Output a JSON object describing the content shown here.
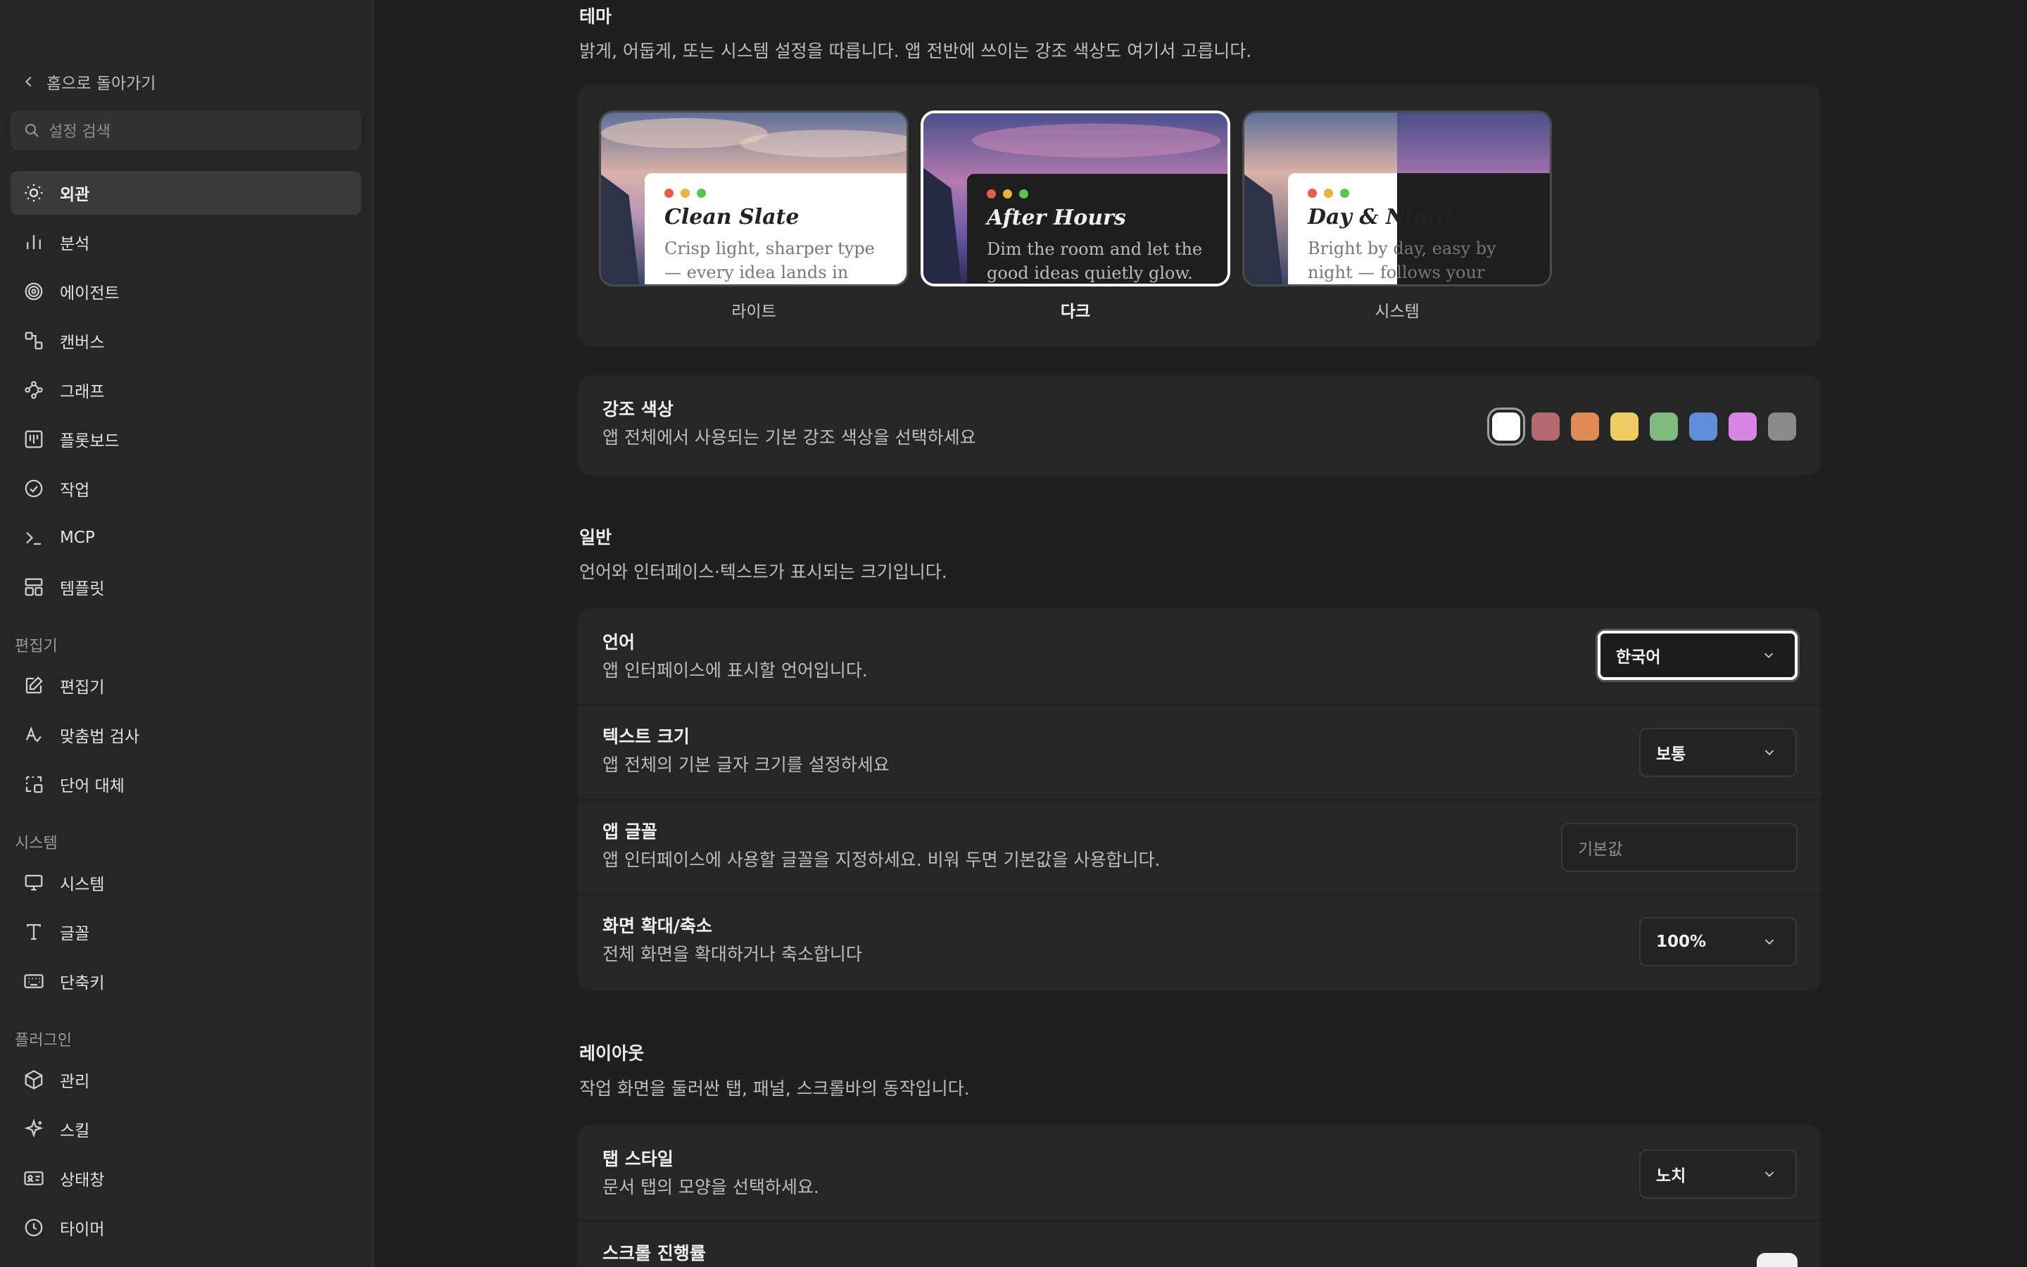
{
  "sidebar": {
    "back_label": "홈으로 돌아가기",
    "search_placeholder": "설정 검색",
    "items": [
      {
        "label": "외관",
        "icon": "sun-icon"
      },
      {
        "label": "분석",
        "icon": "bar-chart-icon"
      },
      {
        "label": "에이전트",
        "icon": "spiral-icon"
      },
      {
        "label": "캔버스",
        "icon": "canvas-icon"
      },
      {
        "label": "그래프",
        "icon": "graph-icon"
      },
      {
        "label": "플롯보드",
        "icon": "board-icon"
      },
      {
        "label": "작업",
        "icon": "check-circle-icon"
      },
      {
        "label": "MCP",
        "icon": "terminal-icon"
      },
      {
        "label": "템플릿",
        "icon": "template-icon"
      }
    ],
    "section_editor": "편집기",
    "editor_items": [
      {
        "label": "편집기",
        "icon": "edit-icon"
      },
      {
        "label": "맞춤법 검사",
        "icon": "spellcheck-icon"
      },
      {
        "label": "단어 대체",
        "icon": "replace-icon"
      }
    ],
    "section_system": "시스템",
    "system_items": [
      {
        "label": "시스템",
        "icon": "monitor-icon"
      },
      {
        "label": "글꼴",
        "icon": "font-icon"
      },
      {
        "label": "단축키",
        "icon": "keyboard-icon"
      }
    ],
    "section_plugins": "플러그인",
    "plugin_items": [
      {
        "label": "관리",
        "icon": "package-icon"
      },
      {
        "label": "스킬",
        "icon": "sparkle-icon"
      },
      {
        "label": "상태창",
        "icon": "id-card-icon"
      },
      {
        "label": "타이머",
        "icon": "clock-icon"
      }
    ]
  },
  "theme": {
    "title": "테마",
    "description": "밝게, 어둡게, 또는 시스템 설정을 따릅니다. 앱 전반에 쓰이는 강조 색상도 여기서 고릅니다.",
    "options": [
      {
        "label": "라이트",
        "card_title": "Clean Slate",
        "card_text": "Crisp light, sharper type — every idea lands in focus."
      },
      {
        "label": "다크",
        "card_title": "After Hours",
        "card_text": "Dim the room and let the good ideas quietly glow."
      },
      {
        "label": "시스템",
        "card_title": "Day & Night",
        "card_text": "Bright by day, easy by night — follows your system."
      }
    ],
    "selected": "다크"
  },
  "accent": {
    "title": "강조 색상",
    "description": "앱 전체에서 사용되는 기본 강조 색상을 선택하세요",
    "colors": [
      "#ffffff",
      "#b56a70",
      "#e08a55",
      "#f0cd62",
      "#7fba7e",
      "#5f8fd9",
      "#d985e6",
      "#8a8a8a"
    ],
    "selected_index": 0
  },
  "general": {
    "title": "일반",
    "description": "언어와 인터페이스·텍스트가 표시되는 크기입니다.",
    "language": {
      "title": "언어",
      "description": "앱 인터페이스에 표시할 언어입니다.",
      "value": "한국어"
    },
    "text_size": {
      "title": "텍스트 크기",
      "description": "앱 전체의 기본 글자 크기를 설정하세요",
      "value": "보통"
    },
    "app_font": {
      "title": "앱 글꼴",
      "description": "앱 인터페이스에 사용할 글꼴을 지정하세요. 비워 두면 기본값을 사용합니다.",
      "placeholder": "기본값"
    },
    "zoom": {
      "title": "화면 확대/축소",
      "description": "전체 화면을 확대하거나 축소합니다",
      "value": "100%"
    }
  },
  "layout": {
    "title": "레이아웃",
    "description": "작업 화면을 둘러싼 탭, 패널, 스크롤바의 동작입니다.",
    "tab_style": {
      "title": "탭 스타일",
      "description": "문서 탭의 모양을 선택하세요.",
      "value": "노치"
    },
    "scroll_progress": {
      "title": "스크롤 진행률"
    }
  }
}
